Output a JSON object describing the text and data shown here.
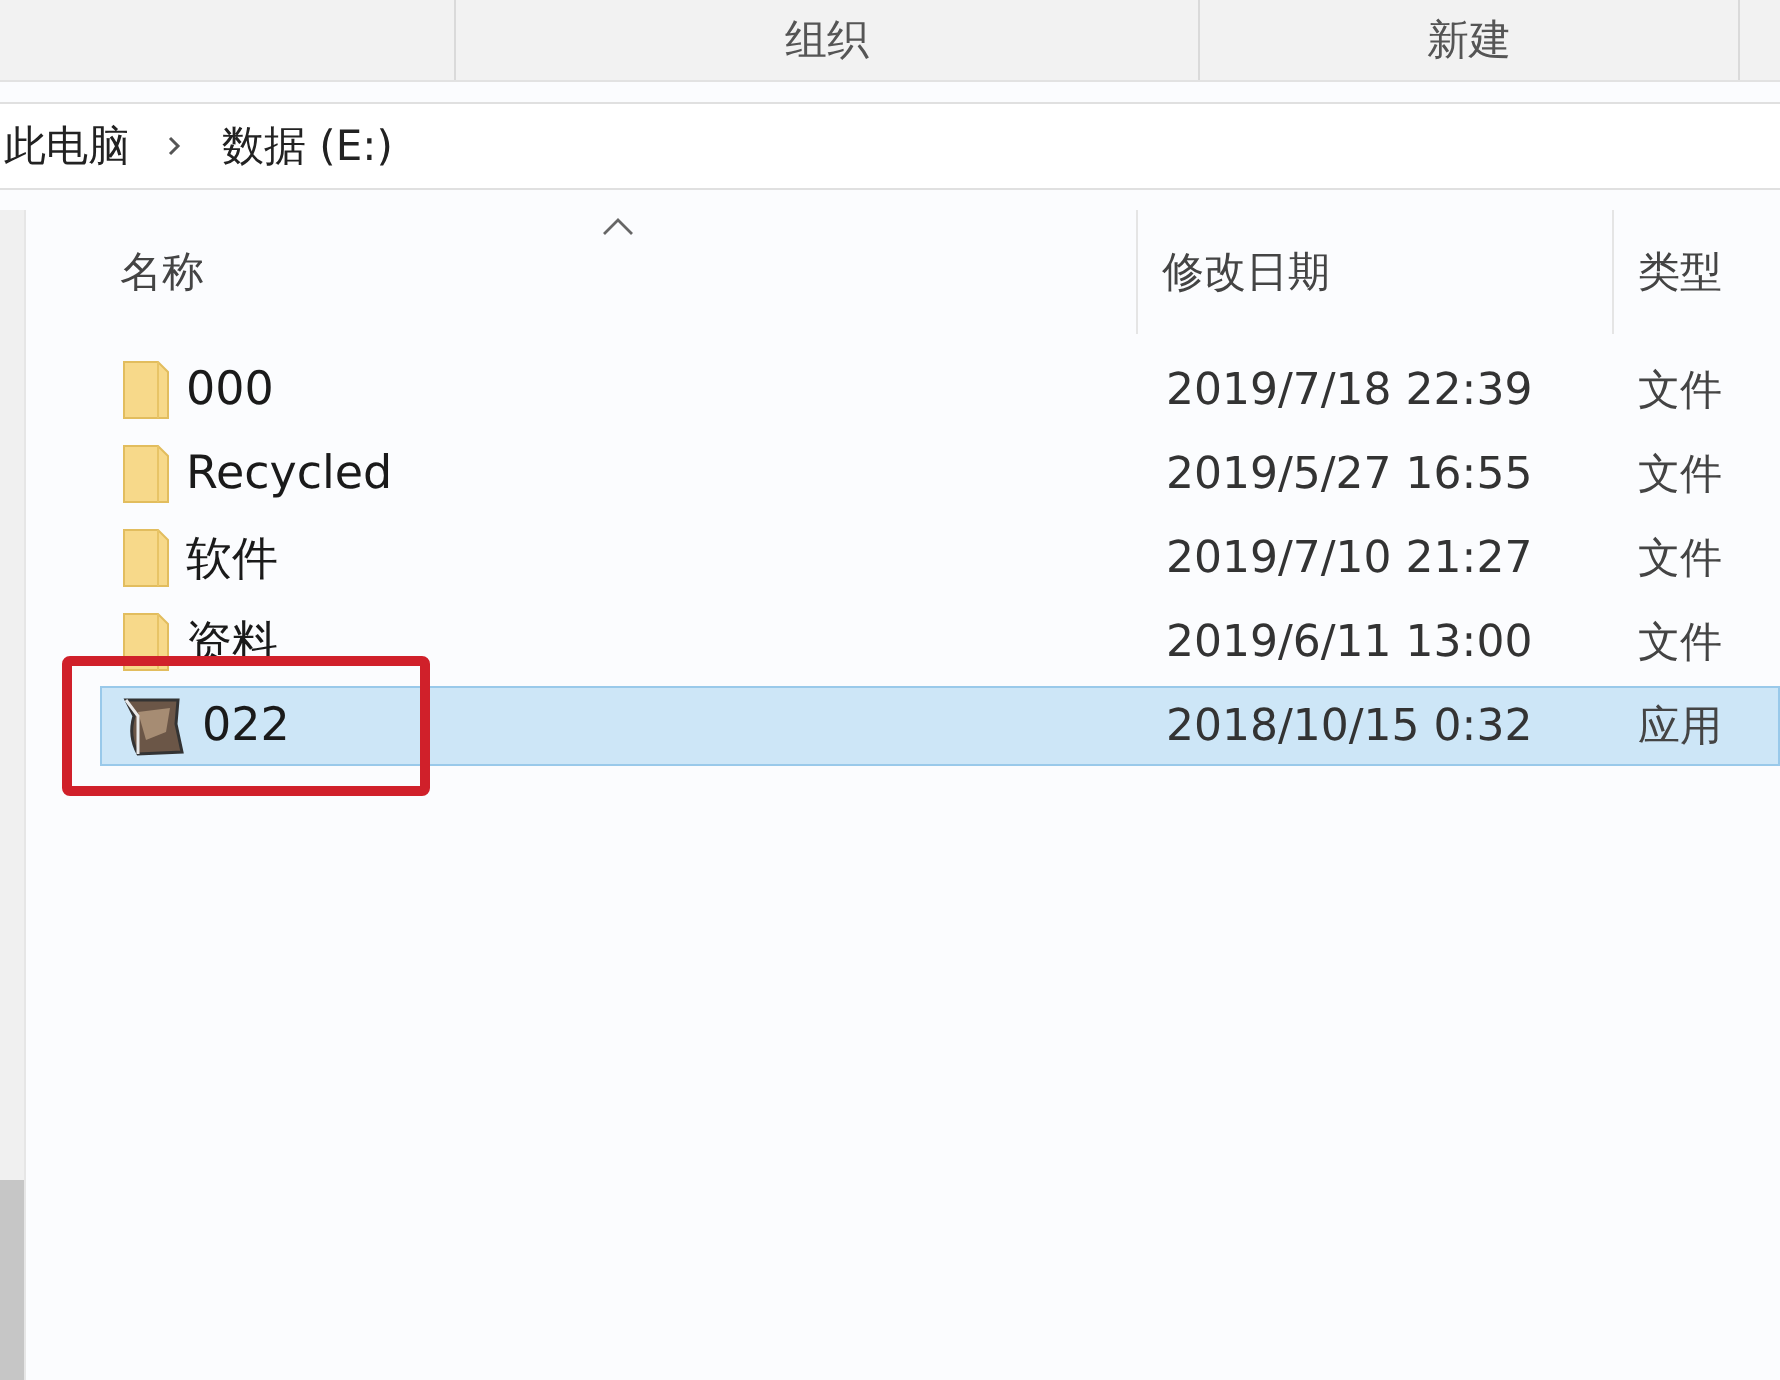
{
  "ribbon": {
    "groups": [
      {
        "label": "组织"
      },
      {
        "label": "新建"
      }
    ]
  },
  "breadcrumb": [
    {
      "label": "此电脑"
    },
    {
      "label": "数据 (E:)"
    }
  ],
  "columns": [
    {
      "label": "名称",
      "sorted": true
    },
    {
      "label": "修改日期",
      "sorted": false
    },
    {
      "label": "类型",
      "sorted": false
    }
  ],
  "files": [
    {
      "kind": "folder",
      "name": "000",
      "date": "2019/7/18 22:39",
      "type": "文件",
      "selected": false,
      "highlighted": false
    },
    {
      "kind": "folder",
      "name": "Recycled",
      "date": "2019/5/27 16:55",
      "type": "文件",
      "selected": false,
      "highlighted": false
    },
    {
      "kind": "folder",
      "name": "软件",
      "date": "2019/7/10 21:27",
      "type": "文件",
      "selected": false,
      "highlighted": false
    },
    {
      "kind": "folder",
      "name": "资料",
      "date": "2019/6/11 13:00",
      "type": "文件",
      "selected": false,
      "highlighted": false
    },
    {
      "kind": "app",
      "name": "022",
      "date": "2018/10/15 0:32",
      "type": "应用",
      "selected": true,
      "highlighted": true
    }
  ]
}
